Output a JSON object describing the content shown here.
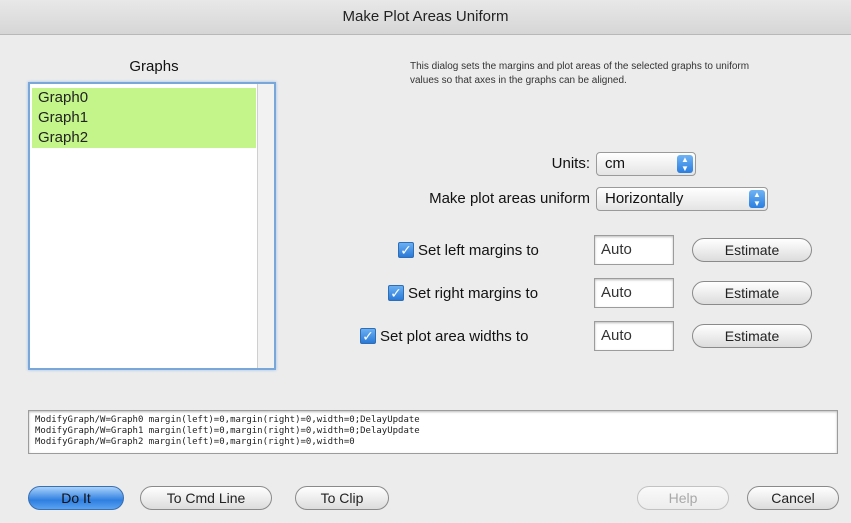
{
  "window": {
    "title": "Make Plot Areas Uniform"
  },
  "graphs": {
    "label": "Graphs",
    "items": [
      "Graph0",
      "Graph1",
      "Graph2"
    ]
  },
  "description": "This dialog sets the margins and plot areas of the selected graphs to uniform values so that axes in the graphs can be aligned.",
  "units": {
    "label": "Units:",
    "value": "cm"
  },
  "uniform": {
    "label": "Make plot areas uniform",
    "value": "Horizontally"
  },
  "rows": [
    {
      "label": "Set left margins to",
      "checked": true,
      "value": "Auto",
      "button": "Estimate"
    },
    {
      "label": "Set right margins to",
      "checked": true,
      "value": "Auto",
      "button": "Estimate"
    },
    {
      "label": "Set plot area widths to",
      "checked": true,
      "value": "Auto",
      "button": "Estimate"
    }
  ],
  "command_lines": [
    "ModifyGraph/W=Graph0 margin(left)=0,margin(right)=0,width=0;DelayUpdate",
    "ModifyGraph/W=Graph1 margin(left)=0,margin(right)=0,width=0;DelayUpdate",
    "ModifyGraph/W=Graph2 margin(left)=0,margin(right)=0,width=0"
  ],
  "buttons": {
    "do_it": "Do It",
    "to_cmd_line": "To Cmd Line",
    "to_clip": "To Clip",
    "help": "Help",
    "cancel": "Cancel"
  },
  "colors": {
    "selection": "#c4f58a",
    "accent": "#2b79d8"
  },
  "icons": {
    "check": "check-icon",
    "popup_arrows": "up-down-arrows-icon"
  }
}
